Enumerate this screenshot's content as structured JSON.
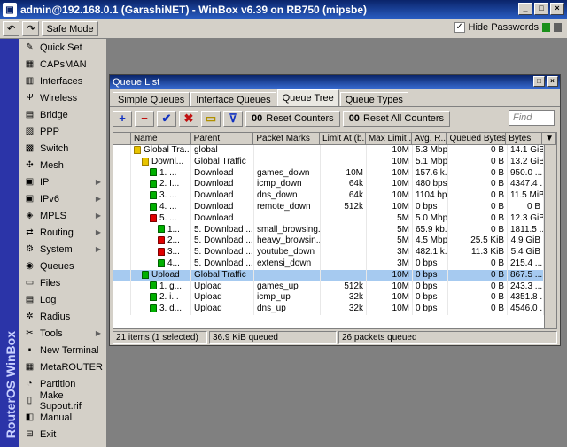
{
  "window": {
    "title": "admin@192.168.0.1 (GarashiNET) - WinBox v6.39 on RB750 (mipsbe)",
    "hide_passwords_label": "Hide Passwords",
    "hide_passwords_checked": "✓"
  },
  "toolbar": {
    "undo": "↶",
    "redo": "↷",
    "safe_mode": "Safe Mode"
  },
  "brand": "RouterOS WinBox",
  "menu": [
    {
      "label": "Quick Set",
      "icon": "✎",
      "arrow": ""
    },
    {
      "label": "CAPsMAN",
      "icon": "▦",
      "arrow": ""
    },
    {
      "label": "Interfaces",
      "icon": "▥",
      "arrow": ""
    },
    {
      "label": "Wireless",
      "icon": "Ψ",
      "arrow": ""
    },
    {
      "label": "Bridge",
      "icon": "▤",
      "arrow": ""
    },
    {
      "label": "PPP",
      "icon": "▧",
      "arrow": ""
    },
    {
      "label": "Switch",
      "icon": "▩",
      "arrow": ""
    },
    {
      "label": "Mesh",
      "icon": "✣",
      "arrow": ""
    },
    {
      "label": "IP",
      "icon": "▣",
      "arrow": "▶"
    },
    {
      "label": "IPv6",
      "icon": "▣",
      "arrow": "▶"
    },
    {
      "label": "MPLS",
      "icon": "◈",
      "arrow": "▶"
    },
    {
      "label": "Routing",
      "icon": "⇄",
      "arrow": "▶"
    },
    {
      "label": "System",
      "icon": "⚙",
      "arrow": "▶"
    },
    {
      "label": "Queues",
      "icon": "◉",
      "arrow": ""
    },
    {
      "label": "Files",
      "icon": "▭",
      "arrow": ""
    },
    {
      "label": "Log",
      "icon": "▤",
      "arrow": ""
    },
    {
      "label": "Radius",
      "icon": "✲",
      "arrow": ""
    },
    {
      "label": "Tools",
      "icon": "✂",
      "arrow": "▶"
    },
    {
      "label": "New Terminal",
      "icon": "▪",
      "arrow": ""
    },
    {
      "label": "MetaROUTER",
      "icon": "▦",
      "arrow": ""
    },
    {
      "label": "Partition",
      "icon": "◔",
      "arrow": ""
    },
    {
      "label": "Make Supout.rif",
      "icon": "▯",
      "arrow": ""
    },
    {
      "label": "Manual",
      "icon": "◧",
      "arrow": ""
    },
    {
      "label": "Exit",
      "icon": "⊟",
      "arrow": ""
    }
  ],
  "queue_window": {
    "title": "Queue List",
    "tabs": [
      "Simple Queues",
      "Interface Queues",
      "Queue Tree",
      "Queue Types"
    ],
    "active_tab": 2,
    "tools": {
      "add": "+",
      "remove": "−",
      "enable": "✔",
      "disable": "✖",
      "comment": "▭",
      "filter": "⊽",
      "reset_counters": "Reset Counters",
      "reset_all_counters": "Reset All Counters",
      "counter_prefix": "00",
      "find_placeholder": "Find"
    },
    "columns": [
      "",
      "Name",
      "Parent",
      "Packet Marks",
      "Limit At (b...",
      "Max Limit ...",
      "Avg. R...",
      "Queued Bytes",
      "Bytes",
      "▼"
    ],
    "rows": [
      {
        "indent": 0,
        "icon": "yellow",
        "name": "Global Tra...",
        "parent": "global",
        "marks": "",
        "limit_at": "",
        "max_limit": "10M",
        "avg_rate": "5.3 Mbps",
        "queued": "0 B",
        "bytes": "14.1 GiB",
        "selected": false
      },
      {
        "indent": 1,
        "icon": "yellow",
        "name": "Downl...",
        "parent": "Global Traffic",
        "marks": "",
        "limit_at": "",
        "max_limit": "10M",
        "avg_rate": "5.1 Mbps",
        "queued": "0 B",
        "bytes": "13.2 GiB",
        "selected": false
      },
      {
        "indent": 2,
        "icon": "green",
        "name": "1. ...",
        "parent": "Download",
        "marks": "games_down",
        "limit_at": "10M",
        "max_limit": "10M",
        "avg_rate": "157.6 k...",
        "queued": "0 B",
        "bytes": "950.0 ...",
        "selected": false
      },
      {
        "indent": 2,
        "icon": "green",
        "name": "2. I...",
        "parent": "Download",
        "marks": "icmp_down",
        "limit_at": "64k",
        "max_limit": "10M",
        "avg_rate": "480 bps",
        "queued": "0 B",
        "bytes": "4347.4 ...",
        "selected": false
      },
      {
        "indent": 2,
        "icon": "green",
        "name": "3. ...",
        "parent": "Download",
        "marks": "dns_down",
        "limit_at": "64k",
        "max_limit": "10M",
        "avg_rate": "1104 bps",
        "queued": "0 B",
        "bytes": "11.5 MiB",
        "selected": false
      },
      {
        "indent": 2,
        "icon": "green",
        "name": "4. ...",
        "parent": "Download",
        "marks": "remote_down",
        "limit_at": "512k",
        "max_limit": "10M",
        "avg_rate": "0 bps",
        "queued": "0 B",
        "bytes": "0 B",
        "selected": false
      },
      {
        "indent": 2,
        "icon": "red",
        "name": "5. ...",
        "parent": "Download",
        "marks": "",
        "limit_at": "",
        "max_limit": "5M",
        "avg_rate": "5.0 Mbps",
        "queued": "0 B",
        "bytes": "12.3 GiB",
        "selected": false
      },
      {
        "indent": 3,
        "icon": "green",
        "name": "1...",
        "parent": "5. Download ...",
        "marks": "small_browsing...",
        "limit_at": "",
        "max_limit": "5M",
        "avg_rate": "65.9 kb...",
        "queued": "0 B",
        "bytes": "1811.5 ...",
        "selected": false
      },
      {
        "indent": 3,
        "icon": "red",
        "name": "2...",
        "parent": "5. Download ...",
        "marks": "heavy_browsin...",
        "limit_at": "",
        "max_limit": "5M",
        "avg_rate": "4.5 Mbps",
        "queued": "25.5 KiB",
        "bytes": "4.9 GiB",
        "selected": false
      },
      {
        "indent": 3,
        "icon": "red",
        "name": "3...",
        "parent": "5. Download ...",
        "marks": "youtube_down",
        "limit_at": "",
        "max_limit": "3M",
        "avg_rate": "482.1 k...",
        "queued": "11.3 KiB",
        "bytes": "5.4 GiB",
        "selected": false
      },
      {
        "indent": 3,
        "icon": "green",
        "name": "4...",
        "parent": "5. Download ...",
        "marks": "extensi_down",
        "limit_at": "",
        "max_limit": "3M",
        "avg_rate": "0 bps",
        "queued": "0 B",
        "bytes": "215.4 ...",
        "selected": false
      },
      {
        "indent": 1,
        "icon": "green",
        "name": "Upload",
        "parent": "Global Traffic",
        "marks": "",
        "limit_at": "",
        "max_limit": "10M",
        "avg_rate": "0 bps",
        "queued": "0 B",
        "bytes": "867.5 ...",
        "selected": true
      },
      {
        "indent": 2,
        "icon": "green",
        "name": "1. g...",
        "parent": "Upload",
        "marks": "games_up",
        "limit_at": "512k",
        "max_limit": "10M",
        "avg_rate": "0 bps",
        "queued": "0 B",
        "bytes": "243.3 ...",
        "selected": false
      },
      {
        "indent": 2,
        "icon": "green",
        "name": "2. i...",
        "parent": "Upload",
        "marks": "icmp_up",
        "limit_at": "32k",
        "max_limit": "10M",
        "avg_rate": "0 bps",
        "queued": "0 B",
        "bytes": "4351.8 ...",
        "selected": false
      },
      {
        "indent": 2,
        "icon": "green",
        "name": "3. d...",
        "parent": "Upload",
        "marks": "dns_up",
        "limit_at": "32k",
        "max_limit": "10M",
        "avg_rate": "0 bps",
        "queued": "0 B",
        "bytes": "4546.0 ...",
        "selected": false
      }
    ],
    "status": {
      "items": "21 items (1 selected)",
      "queued": "36.9 KiB queued",
      "packets": "26 packets queued"
    }
  },
  "colors": {
    "brand_bar": "#2b34a8",
    "title_bar": "#0a246a",
    "selection": "#a6caf0"
  }
}
